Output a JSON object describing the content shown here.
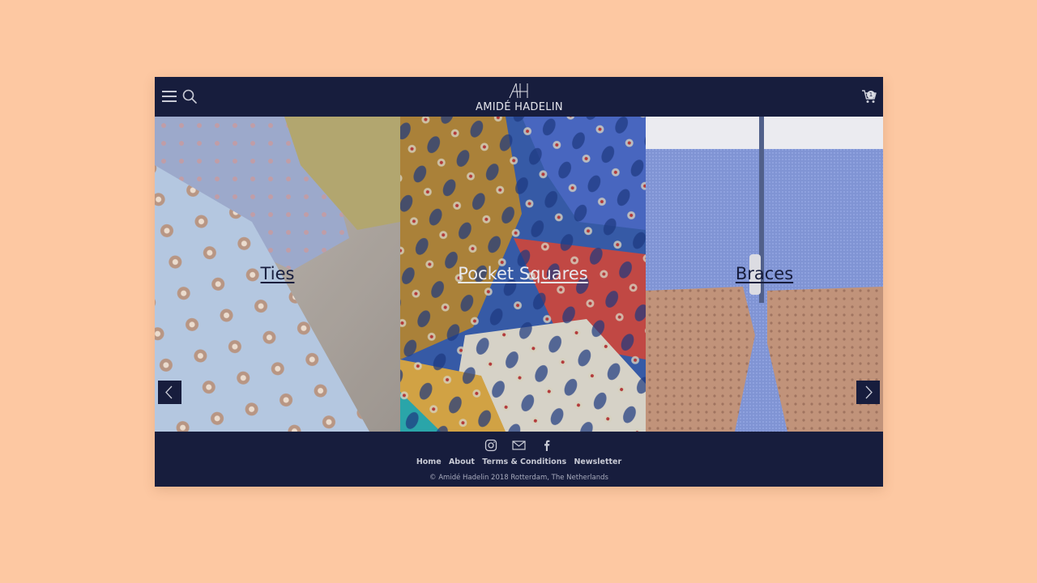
{
  "header": {
    "brand": "AMIDÉ HADELIN",
    "cart_count": "1",
    "icons": {
      "menu": "hamburger-icon",
      "search": "search-icon",
      "cart": "cart-icon"
    }
  },
  "categories": [
    {
      "label": "Ties"
    },
    {
      "label": "Pocket Squares"
    },
    {
      "label": "Braces"
    }
  ],
  "carousel": {
    "prev_icon": "chevron-left-icon",
    "next_icon": "chevron-right-icon"
  },
  "footer": {
    "social_icons": [
      "instagram-icon",
      "mail-icon",
      "facebook-icon"
    ],
    "nav": [
      "Home",
      "About",
      "Terms & Conditions",
      "Newsletter"
    ],
    "copyright": "© Amidé Hadelin 2018 Rotterdam, The Netherlands"
  },
  "colors": {
    "page_background": "#fdc8a2",
    "navy": "#171d3d",
    "text_light": "#c7c9d4"
  }
}
